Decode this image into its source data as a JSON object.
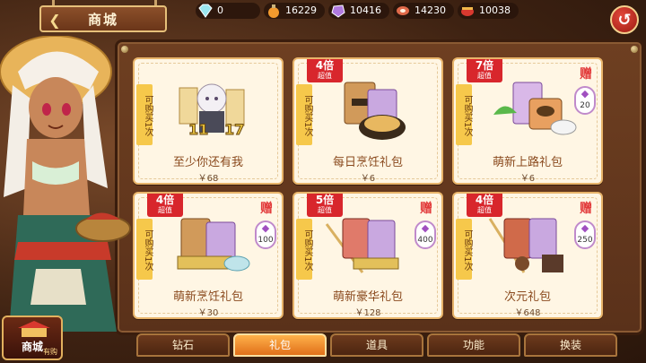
{
  "header": {
    "title": "商城",
    "back_symbol": "❮"
  },
  "currency": [
    {
      "icon": "diamond-icon",
      "value": "0"
    },
    {
      "icon": "potion-icon",
      "value": "16229"
    },
    {
      "icon": "amethyst-icon",
      "value": "10416"
    },
    {
      "icon": "meat-icon",
      "value": "14230"
    },
    {
      "icon": "pot-icon",
      "value": "10038"
    }
  ],
  "return_symbol": "↺",
  "cards": [
    {
      "limit": "可购买1次",
      "ribbon_mult": "",
      "ribbon_worth": "",
      "gift": "",
      "bonus": "",
      "name": "至少你还有我",
      "price": "￥68"
    },
    {
      "limit": "可购买1次",
      "ribbon_mult": "4倍",
      "ribbon_worth": "超值",
      "gift": "",
      "bonus": "",
      "name": "每日烹饪礼包",
      "price": "￥6"
    },
    {
      "limit": "可购买1次",
      "ribbon_mult": "7倍",
      "ribbon_worth": "超值",
      "gift": "赠",
      "bonus": "20",
      "name": "萌新上路礼包",
      "price": "￥6"
    },
    {
      "limit": "可购买1次",
      "ribbon_mult": "4倍",
      "ribbon_worth": "超值",
      "gift": "赠",
      "bonus": "100",
      "name": "萌新烹饪礼包",
      "price": "￥30"
    },
    {
      "limit": "可购买1次",
      "ribbon_mult": "5倍",
      "ribbon_worth": "超值",
      "gift": "赠",
      "bonus": "400",
      "name": "萌新豪华礼包",
      "price": "￥128"
    },
    {
      "limit": "可购买1次",
      "ribbon_mult": "4倍",
      "ribbon_worth": "超值",
      "gift": "赠",
      "bonus": "250",
      "name": "次元礼包",
      "price": "￥648"
    }
  ],
  "tabs": [
    {
      "label": "钻石",
      "active": false
    },
    {
      "label": "礼包",
      "active": true
    },
    {
      "label": "道具",
      "active": false
    },
    {
      "label": "功能",
      "active": false
    },
    {
      "label": "换装",
      "active": false
    }
  ],
  "shop_logo": {
    "label": "商城",
    "sub": "有购"
  },
  "colors": {
    "ribbon": "#d8262c",
    "limit_tag": "#f6c84b",
    "active_tab": "#e0701a",
    "card_bg": "#fff6e4"
  }
}
